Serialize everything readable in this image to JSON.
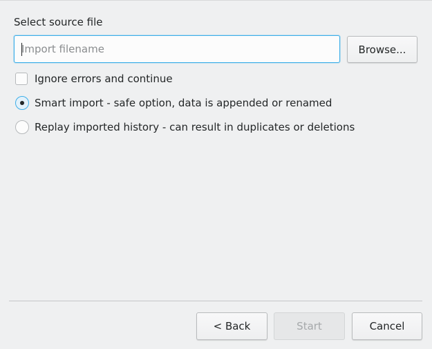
{
  "source": {
    "label": "Select source file",
    "filename_value": "",
    "filename_placeholder": "Import filename",
    "browse_label": "Browse..."
  },
  "options": {
    "ignore_errors": {
      "label": "Ignore errors and continue",
      "checked": false
    },
    "smart_import": {
      "label": "Smart import - safe option, data is appended or renamed",
      "selected": true
    },
    "replay_history": {
      "label": "Replay imported history - can result in duplicates or deletions",
      "selected": false
    }
  },
  "buttons": {
    "back_label": "< Back",
    "start_label": "Start",
    "cancel_label": "Cancel"
  },
  "colors": {
    "background": "#eff0f1",
    "focus_accent": "#3daee9",
    "text": "#232627",
    "disabled_text": "#a5a8aa"
  }
}
